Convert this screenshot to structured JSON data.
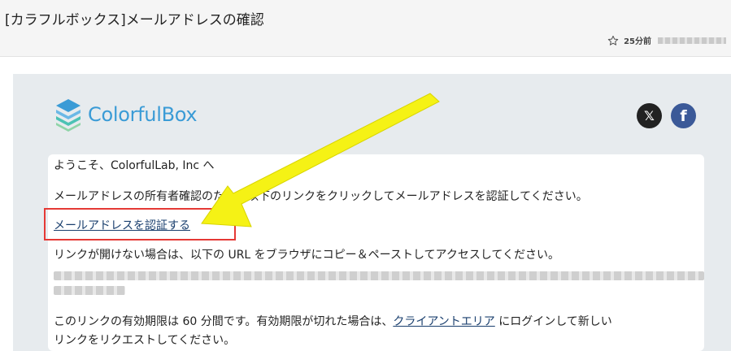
{
  "email": {
    "subject": "[カラフルボックス]メールアドレスの確認",
    "time": "25分前"
  },
  "brand": {
    "name": "ColorfulBox",
    "color": "#3a9bd6"
  },
  "social": {
    "x_label": "𝕏",
    "facebook_label": "f"
  },
  "body": {
    "greeting": "ようこそ、ColorfulLab, Inc へ",
    "instruction": "メールアドレスの所有者確認のため、以下のリンクをクリックしてメールアドレスを認証してください。",
    "verify_link": "メールアドレスを認証する",
    "fallback": "リンクが開けない場合は、以下の URL をブラウザにコピー＆ペーストしてアクセスしてください。",
    "expiry_prefix": "このリンクの有効期限は 60 分間です。有効期限が切れた場合は、",
    "client_area_link": "クライアントエリア",
    "expiry_suffix": " にログインして新しい",
    "expiry_line2": "リンクをリクエストしてください。"
  },
  "annotation": {
    "highlight_color": "#e53935",
    "arrow_color": "#f5f215"
  }
}
